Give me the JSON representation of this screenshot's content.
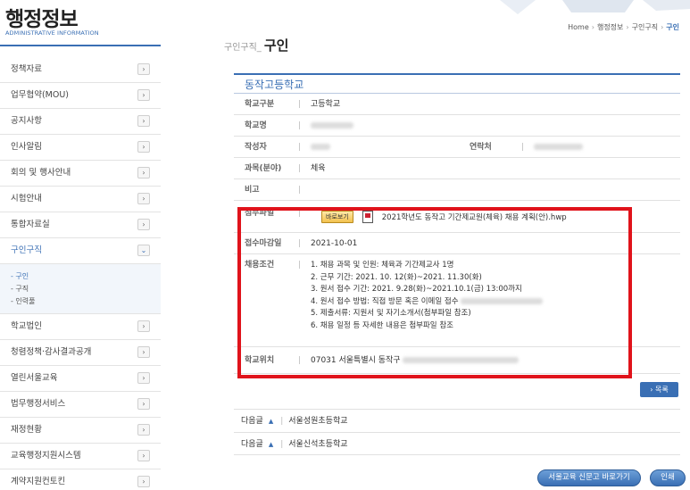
{
  "brand": {
    "title": "행정정보",
    "subtitle": "ADMINISTRATIVE INFORMATION"
  },
  "sidebar": {
    "items_top": [
      {
        "label": "정책자료"
      },
      {
        "label": "업무협약(MOU)"
      },
      {
        "label": "공지사항"
      },
      {
        "label": "인사알림"
      },
      {
        "label": "회의 및 행사안내"
      },
      {
        "label": "시험안내"
      },
      {
        "label": "통합자료실"
      }
    ],
    "active_item": {
      "label": "구인구직"
    },
    "submenu": [
      {
        "label": "- 구인"
      },
      {
        "label": "- 구직"
      },
      {
        "label": "- 인력풀"
      }
    ],
    "items_bottom": [
      {
        "label": "학교법인"
      },
      {
        "label": "청렴정책·감사결과공개"
      },
      {
        "label": "열린서울교육"
      },
      {
        "label": "법무행정서비스"
      },
      {
        "label": "재정현황"
      },
      {
        "label": "교육행정지원시스템"
      },
      {
        "label": "계약지원컨토킨"
      }
    ],
    "chevron_right": "›",
    "chevron_down": "⌄"
  },
  "breadcrumb": {
    "home": "Home",
    "level1": "행정정보",
    "level2": "구인구직",
    "current": "구인",
    "separator": "›"
  },
  "heading": {
    "prefix": "구인구직_",
    "title": "구인"
  },
  "detail": {
    "school_name": "동작고등학교",
    "bar": "|",
    "fields": {
      "type_label": "학교구분",
      "type_value": "고등학교",
      "school_label": "학교명",
      "writer_label": "작성자",
      "contact_label": "연락처",
      "subject_label": "과목(분야)",
      "subject_value": "체육",
      "note_label": "비고",
      "attach_label": "첨부파일",
      "viewer_label": "바로보기",
      "file_name": "2021학년도 동작고 기간제교원(체육) 채용 계획(안).hwp",
      "deadline_label": "접수마감일",
      "deadline_value": "2021-10-01",
      "conditions_label": "채용조건",
      "conditions": [
        "1. 채용 과목 및 인원: 체육과 기간제교사 1명",
        "2. 근무 기간: 2021. 10. 12(화)~2021. 11.30(화)",
        "3. 원서 접수 기간: 2021. 9.28(화)~2021.10.1(금) 13:00까지",
        "4. 원서 접수 방법: 직접 방문 혹은 이메일 접수",
        "5. 제출서류: 지원서 및 자기소개서(첨부파일 참조)",
        "6. 채용 일정 등 자세한 내용은 첨부파일 참조"
      ],
      "location_label": "학교위치",
      "location_value": "07031 서울특별시 동작구"
    },
    "list_button": "› 목록"
  },
  "prevnext": [
    {
      "label": "다음글",
      "arrow": "▲",
      "title": "서울성원초등학교"
    },
    {
      "label": "다음글",
      "arrow": "▲",
      "title": "서울신석초등학교"
    }
  ],
  "footer": {
    "news_button": "서울교육 신문고 바로가기",
    "print_button": "인쇄"
  },
  "colors": {
    "accent": "#3a6fb4",
    "highlight": "#e0131b"
  }
}
